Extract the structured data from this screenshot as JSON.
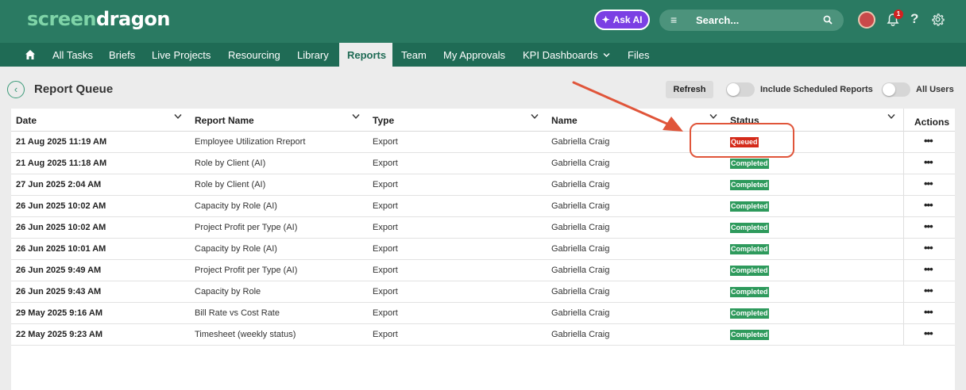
{
  "app": {
    "logo_part1": "screen",
    "logo_part2": "dragon",
    "ask_ai": "Ask AI",
    "search_placeholder": "Search...",
    "notification_count": "1",
    "help": "?"
  },
  "nav": {
    "items": [
      "All Tasks",
      "Briefs",
      "Live Projects",
      "Resourcing",
      "Library",
      "Reports",
      "Team",
      "My Approvals",
      "KPI Dashboards",
      "Files"
    ],
    "active": "Reports"
  },
  "page": {
    "title": "Report Queue",
    "refresh": "Refresh",
    "include_scheduled": "Include Scheduled Reports",
    "all_users": "All Users"
  },
  "table": {
    "headers": {
      "date": "Date",
      "report_name": "Report Name",
      "type": "Type",
      "name": "Name",
      "status": "Status",
      "actions": "Actions"
    },
    "rows": [
      {
        "date": "21 Aug 2025 11:19  AM",
        "report_name": "Employee Utilization Rreport",
        "type": "Export",
        "name": "Gabriella Craig",
        "status": "Queued",
        "actions": "•••"
      },
      {
        "date": "21 Aug 2025 11:18  AM",
        "report_name": "Role by Client (AI)",
        "type": "Export",
        "name": "Gabriella Craig",
        "status": "Completed",
        "actions": "•••"
      },
      {
        "date": "27 Jun 2025 2:04  AM",
        "report_name": "Role by Client (AI)",
        "type": "Export",
        "name": "Gabriella Craig",
        "status": "Completed",
        "actions": "•••"
      },
      {
        "date": "26 Jun 2025 10:02  AM",
        "report_name": "Capacity by Role (AI)",
        "type": "Export",
        "name": "Gabriella Craig",
        "status": "Completed",
        "actions": "•••"
      },
      {
        "date": "26 Jun 2025 10:02  AM",
        "report_name": "Project Profit per Type (AI)",
        "type": "Export",
        "name": "Gabriella Craig",
        "status": "Completed",
        "actions": "•••"
      },
      {
        "date": "26 Jun 2025 10:01  AM",
        "report_name": "Capacity by Role (AI)",
        "type": "Export",
        "name": "Gabriella Craig",
        "status": "Completed",
        "actions": "•••"
      },
      {
        "date": "26 Jun 2025 9:49  AM",
        "report_name": "Project Profit per Type (AI)",
        "type": "Export",
        "name": "Gabriella Craig",
        "status": "Completed",
        "actions": "•••"
      },
      {
        "date": "26 Jun 2025 9:43  AM",
        "report_name": "Capacity by Role",
        "type": "Export",
        "name": "Gabriella Craig",
        "status": "Completed",
        "actions": "•••"
      },
      {
        "date": "29 May 2025 9:16  AM",
        "report_name": "Bill Rate vs Cost Rate",
        "type": "Export",
        "name": "Gabriella Craig",
        "status": "Completed",
        "actions": "•••"
      },
      {
        "date": "22 May 2025 9:23  AM",
        "report_name": "Timesheet (weekly status)",
        "type": "Export",
        "name": "Gabriella Craig",
        "status": "Completed",
        "actions": "•••"
      }
    ]
  },
  "colors": {
    "header_bg": "#2a7a62",
    "nav_bg": "#1f6b55",
    "queued": "#d42a1a",
    "completed": "#2e9a5c",
    "annotation": "#e0553a"
  }
}
